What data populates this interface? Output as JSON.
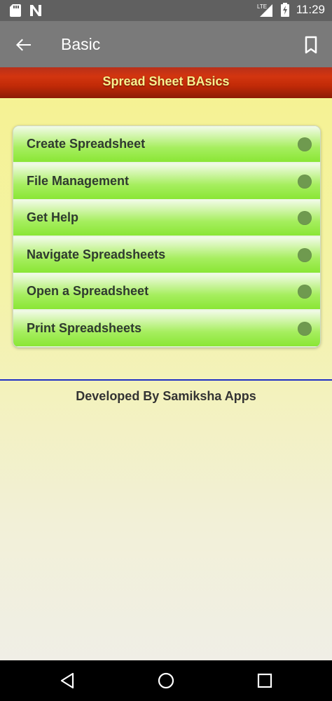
{
  "status_bar": {
    "time": "11:29",
    "network": "LTE",
    "icons": [
      "sd-card-icon",
      "n-notification-icon",
      "lte-signal-icon",
      "battery-icon"
    ]
  },
  "app_bar": {
    "title": "Basic",
    "back_icon": "arrow-left-icon",
    "bookmark_icon": "bookmark-icon"
  },
  "banner": {
    "title": "Spread Sheet BAsics"
  },
  "menu": {
    "items": [
      {
        "label": "Create Spreadsheet"
      },
      {
        "label": "File Management"
      },
      {
        "label": "Get Help"
      },
      {
        "label": "Navigate Spreadsheets"
      },
      {
        "label": "Open a Spreadsheet"
      },
      {
        "label": "Print Spreadsheets"
      }
    ]
  },
  "footer": {
    "text": "Developed By Samiksha Apps"
  },
  "nav_bar": {
    "icons": [
      "back-triangle-icon",
      "home-circle-icon",
      "recents-square-icon"
    ]
  },
  "colors": {
    "status_bar": "#606060",
    "app_bar": "#7a7a7a",
    "banner": "#c12a07",
    "banner_text": "#f7f18f",
    "menu_green": "#8ae635",
    "divider": "#1e2fc4"
  }
}
